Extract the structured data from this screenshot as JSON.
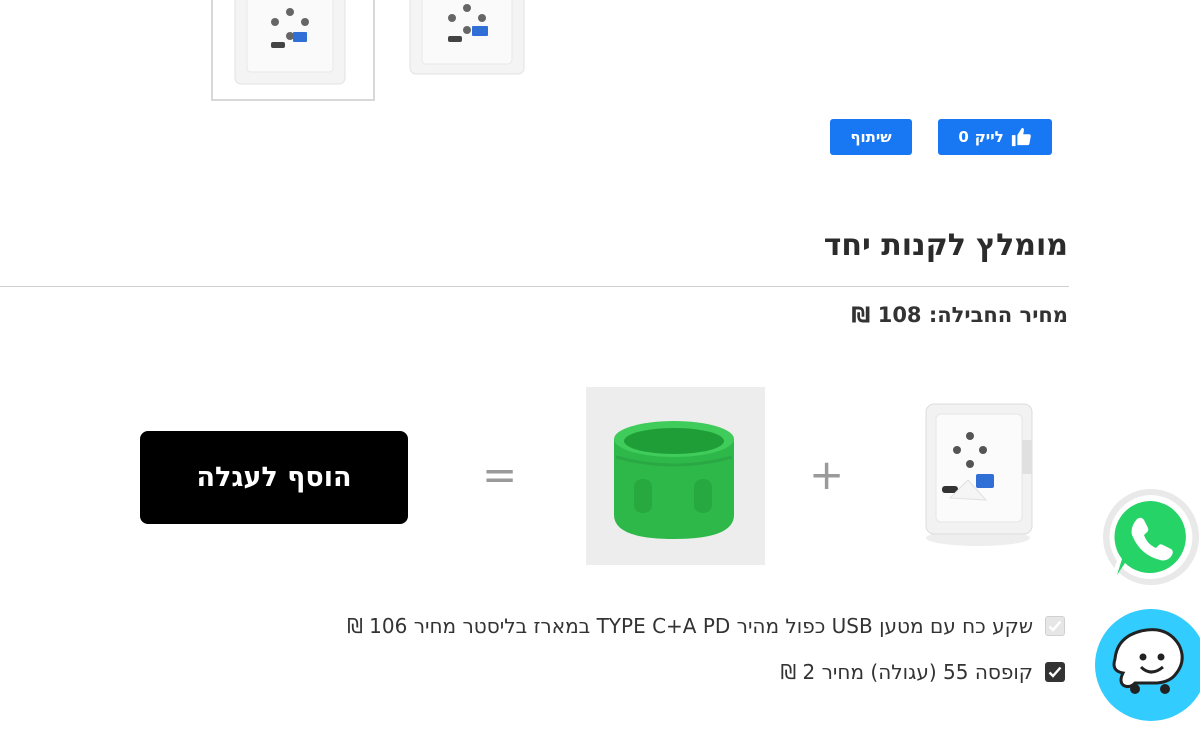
{
  "gallery": {
    "thumbnails": [
      "socket-thumbnail-1",
      "socket-thumbnail-2"
    ]
  },
  "social": {
    "like_label": "לייק",
    "like_count": "0",
    "share_label": "שיתוף",
    "color": "#1877f2"
  },
  "bundle": {
    "title": "מומלץ לקנות יחד",
    "price_label": "מחיר החבילה:",
    "price_value": "108 ₪",
    "plus_symbol": "+",
    "equals_symbol": "=",
    "add_to_cart_label": "הוסף לעגלה",
    "items": [
      {
        "label": "שקע כח עם מטען USB כפול מהיר TYPE C+A PD במארז בליסטר מחיר 106 ₪",
        "checked": true,
        "disabled": true
      },
      {
        "label": "קופסה 55 (עגולה) מחיר 2 ₪",
        "checked": true,
        "disabled": false
      }
    ]
  },
  "widgets": {
    "whatsapp_color": "#25d366",
    "waze_color": "#33ccff"
  }
}
